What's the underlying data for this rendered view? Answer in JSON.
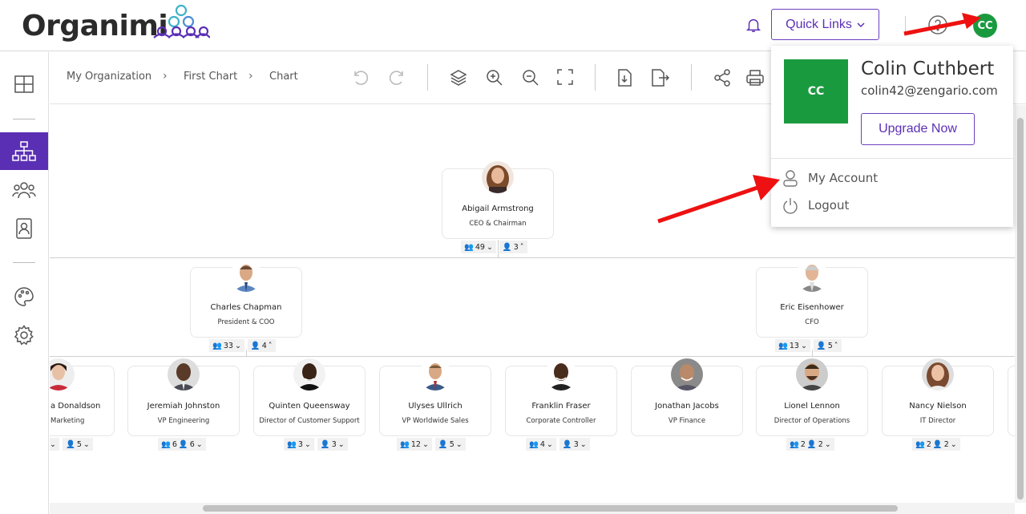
{
  "app": {
    "logo_text": "Organimi"
  },
  "header": {
    "quick_links_label": "Quick Links",
    "avatar_initials": "CC"
  },
  "breadcrumb": [
    "My Organization",
    "First Chart",
    "Chart"
  ],
  "colors": {
    "accent": "#5b2fb4",
    "avatar": "#1a9a3f",
    "arrow": "#ee1111"
  },
  "dropdown": {
    "avatar_initials": "CC",
    "name": "Colin Cuthbert",
    "email": "colin42@zengario.com",
    "upgrade_label": "Upgrade Now",
    "my_account_label": "My Account",
    "logout_label": "Logout"
  },
  "chart": {
    "ceo": {
      "name": "Abigail Armstrong",
      "title": "CEO & Chairman",
      "team": "49",
      "direct": "3"
    },
    "level1": [
      {
        "name": "Charles Chapman",
        "title": "President & COO",
        "team": "33",
        "direct": "4"
      },
      {
        "name": "Eric Eisenhower",
        "title": "CFO",
        "team": "13",
        "direct": "5"
      }
    ],
    "level2": [
      {
        "name": "a Donaldson",
        "title": "Marketing",
        "team": "",
        "direct": "5"
      },
      {
        "name": "Jeremiah Johnston",
        "title": "VP Engineering",
        "team": "6",
        "direct": "6"
      },
      {
        "name": "Quinten Queensway",
        "title": "Director of Customer Support",
        "team": "3",
        "direct": "3"
      },
      {
        "name": "Ulyses Ullrich",
        "title": "VP Worldwide Sales",
        "team": "12",
        "direct": "5"
      },
      {
        "name": "Franklin Fraser",
        "title": "Corporate Controller",
        "team": "4",
        "direct": "3"
      },
      {
        "name": "Jonathan Jacobs",
        "title": "VP Finance",
        "team": "",
        "direct": ""
      },
      {
        "name": "Lionel Lennon",
        "title": "Director of Operations",
        "team": "2",
        "direct": "2"
      },
      {
        "name": "Nancy Nielson",
        "title": "IT Director",
        "team": "2",
        "direct": "2"
      }
    ]
  }
}
